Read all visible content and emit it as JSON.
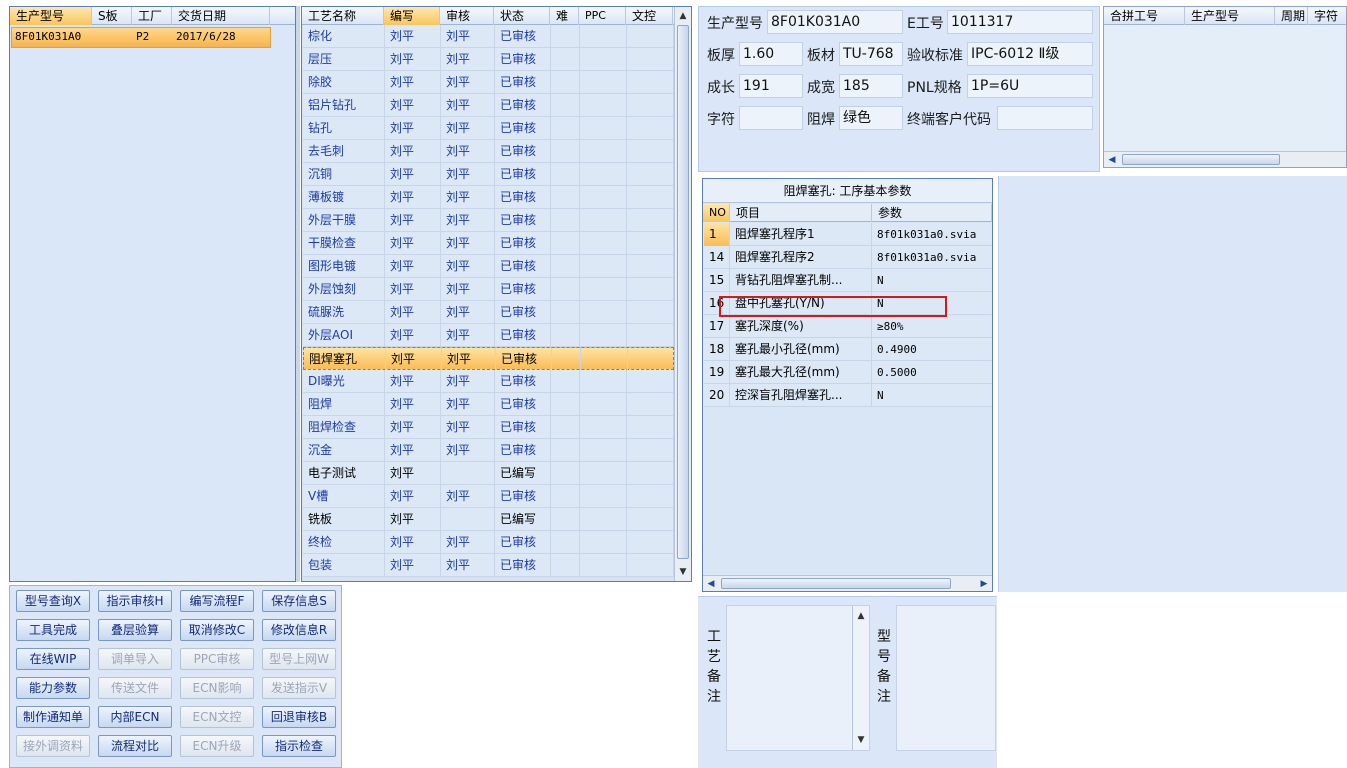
{
  "left": {
    "headers": [
      "生产型号",
      "S板",
      "工厂",
      "交货日期"
    ],
    "row": {
      "model": "8F01K031A0",
      "s": "",
      "factory": "P2",
      "date": "2017/6/28"
    }
  },
  "process": {
    "headers": [
      "工艺名称",
      "编写",
      "审核",
      "状态",
      "难",
      "PPC",
      "文控"
    ],
    "rows": [
      {
        "name": "棕化",
        "author": "刘平",
        "reviewer": "刘平",
        "status": "已审核"
      },
      {
        "name": "层压",
        "author": "刘平",
        "reviewer": "刘平",
        "status": "已审核"
      },
      {
        "name": "除胶",
        "author": "刘平",
        "reviewer": "刘平",
        "status": "已审核"
      },
      {
        "name": "铝片钻孔",
        "author": "刘平",
        "reviewer": "刘平",
        "status": "已审核"
      },
      {
        "name": "钻孔",
        "author": "刘平",
        "reviewer": "刘平",
        "status": "已审核"
      },
      {
        "name": "去毛刺",
        "author": "刘平",
        "reviewer": "刘平",
        "status": "已审核"
      },
      {
        "name": "沉铜",
        "author": "刘平",
        "reviewer": "刘平",
        "status": "已审核"
      },
      {
        "name": "薄板镀",
        "author": "刘平",
        "reviewer": "刘平",
        "status": "已审核"
      },
      {
        "name": "外层干膜",
        "author": "刘平",
        "reviewer": "刘平",
        "status": "已审核"
      },
      {
        "name": "干膜检查",
        "author": "刘平",
        "reviewer": "刘平",
        "status": "已审核"
      },
      {
        "name": "图形电镀",
        "author": "刘平",
        "reviewer": "刘平",
        "status": "已审核"
      },
      {
        "name": "外层蚀刻",
        "author": "刘平",
        "reviewer": "刘平",
        "status": "已审核"
      },
      {
        "name": "硫脲洗",
        "author": "刘平",
        "reviewer": "刘平",
        "status": "已审核"
      },
      {
        "name": "外层AOI",
        "author": "刘平",
        "reviewer": "刘平",
        "status": "已审核"
      },
      {
        "name": "阻焊塞孔",
        "author": "刘平",
        "reviewer": "刘平",
        "status": "已审核"
      },
      {
        "name": "DI曝光",
        "author": "刘平",
        "reviewer": "刘平",
        "status": "已审核"
      },
      {
        "name": "阻焊",
        "author": "刘平",
        "reviewer": "刘平",
        "status": "已审核"
      },
      {
        "name": "阻焊检查",
        "author": "刘平",
        "reviewer": "刘平",
        "status": "已审核"
      },
      {
        "name": "沉金",
        "author": "刘平",
        "reviewer": "刘平",
        "status": "已审核"
      },
      {
        "name": "电子测试",
        "author": "刘平",
        "reviewer": "",
        "status": "已编写"
      },
      {
        "name": "V槽",
        "author": "刘平",
        "reviewer": "刘平",
        "status": "已审核"
      },
      {
        "name": "铣板",
        "author": "刘平",
        "reviewer": "",
        "status": "已编写"
      },
      {
        "name": "终检",
        "author": "刘平",
        "reviewer": "刘平",
        "status": "已审核"
      },
      {
        "name": "包装",
        "author": "刘平",
        "reviewer": "刘平",
        "status": "已审核"
      }
    ],
    "selected_row": "阻焊塞孔"
  },
  "buttons": [
    [
      "型号查询X",
      "指示审核H",
      "编写流程F",
      "保存信息S"
    ],
    [
      "工具完成",
      "叠层验算",
      "取消修改C",
      "修改信息R"
    ],
    [
      "在线WIP",
      "调单导入",
      "PPC审核",
      "型号上网W"
    ],
    [
      "能力参数",
      "传送文件",
      "ECN影响",
      "发送指示V"
    ],
    [
      "制作通知单",
      "内部ECN",
      "ECN文控",
      "回退审核B"
    ],
    [
      "接外调资料",
      "流程对比",
      "ECN升级",
      "指示检查"
    ]
  ],
  "info": {
    "model_label": "生产型号",
    "model_value": "8F01K031A0",
    "eno_label": "E工号",
    "eno_value": "1011317",
    "thickness_label": "板厚",
    "thickness_value": "1.60",
    "material_label": "板材",
    "material_value": "TU-768",
    "standard_label": "验收标准",
    "standard_value": "IPC-6012 Ⅱ级",
    "length_label": "成长",
    "length_value": "191",
    "width_label": "成宽",
    "width_value": "185",
    "pnl_label": "PNL规格",
    "pnl_value": "1P=6U",
    "char_label": "字符",
    "char_value": "",
    "mask_label": "阻焊",
    "mask_value": "绿色",
    "customer_label": "终端客户代码",
    "customer_value": ""
  },
  "combine": {
    "headers": [
      "合拼工号",
      "生产型号",
      "周期",
      "字符"
    ]
  },
  "params": {
    "title": "阻焊塞孔: 工序基本参数",
    "headers": [
      "NO",
      "项目",
      "参数"
    ],
    "rows": [
      {
        "no": "1",
        "item": "阻焊塞孔程序1",
        "value": "8f01k031a0.svia"
      },
      {
        "no": "14",
        "item": "阻焊塞孔程序2",
        "value": "8f01k031a0.svia"
      },
      {
        "no": "15",
        "item": "背钻孔阻焊塞孔制...",
        "value": "N"
      },
      {
        "no": "16",
        "item": "盘中孔塞孔(Y/N)",
        "value": "N"
      },
      {
        "no": "17",
        "item": "塞孔深度(%)",
        "value": "≥80%"
      },
      {
        "no": "18",
        "item": "塞孔最小孔径(mm)",
        "value": "0.4900"
      },
      {
        "no": "19",
        "item": "塞孔最大孔径(mm)",
        "value": "0.5000"
      },
      {
        "no": "20",
        "item": "控深盲孔阻焊塞孔...",
        "value": "N"
      }
    ]
  },
  "remarks": {
    "process_label": [
      "工",
      "艺",
      "备",
      "注"
    ],
    "model_label": [
      "型",
      "号",
      "备",
      "注"
    ]
  },
  "colors": {
    "selection": "#f8bd56",
    "highlight_box": "#d01b1b",
    "text_blue": "#1d3aa5"
  }
}
